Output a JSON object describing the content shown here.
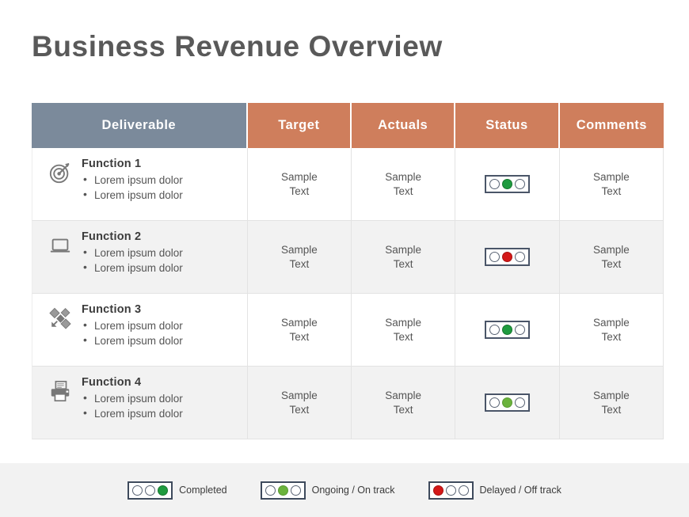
{
  "slide": {
    "title": "Business Revenue Overview",
    "background": "#ffffff",
    "title_color": "#595959"
  },
  "colors": {
    "header_deliverable": "#7b8a9b",
    "header_accent": "#cf7e5c",
    "row_shaded": "#f2f2f2",
    "footer_band": "#f2f2f2",
    "status_green": "#1f9b3f",
    "status_green_light": "#6bb33c",
    "status_red": "#d41818",
    "lamp_outline": "#4a5568"
  },
  "table": {
    "headers": [
      {
        "label": "Deliverable",
        "style": "slate"
      },
      {
        "label": "Target",
        "style": "accent"
      },
      {
        "label": "Actuals",
        "style": "accent"
      },
      {
        "label": "Status",
        "style": "accent"
      },
      {
        "label": "Comments",
        "style": "accent"
      }
    ],
    "rows": [
      {
        "icon": "target-bullseye-icon",
        "title": "Function  1",
        "bullets": [
          "Lorem ipsum dolor",
          "Lorem ipsum dolor"
        ],
        "target": "Sample\nText",
        "target_line1": "Sample",
        "target_line2": "Text",
        "actuals_line1": "Sample",
        "actuals_line2": "Text",
        "comments_line1": "Sample",
        "comments_line2": "Text",
        "status": "ongoing",
        "status_lamps": [
          "off",
          "green",
          "off"
        ],
        "shaded": false
      },
      {
        "icon": "laptop-icon",
        "title": "Function  2",
        "bullets": [
          "Lorem ipsum dolor",
          "Lorem ipsum dolor"
        ],
        "target_line1": "Sample",
        "target_line2": "Text",
        "actuals_line1": "Sample",
        "actuals_line2": "Text",
        "comments_line1": "Sample",
        "comments_line2": "Text",
        "status": "delayed",
        "status_lamps": [
          "off",
          "red",
          "off"
        ],
        "shaded": true
      },
      {
        "icon": "satellite-icon",
        "title": "Function  3",
        "bullets": [
          "Lorem ipsum dolor",
          "Lorem ipsum dolor"
        ],
        "target_line1": "Sample",
        "target_line2": "Text",
        "actuals_line1": "Sample",
        "actuals_line2": "Text",
        "comments_line1": "Sample",
        "comments_line2": "Text",
        "status": "ongoing",
        "status_lamps": [
          "off",
          "green",
          "off"
        ],
        "shaded": false
      },
      {
        "icon": "printer-icon",
        "title": "Function  4",
        "bullets": [
          "Lorem ipsum dolor",
          "Lorem ipsum dolor"
        ],
        "target_line1": "Sample",
        "target_line2": "Text",
        "actuals_line1": "Sample",
        "actuals_line2": "Text",
        "comments_line1": "Sample",
        "comments_line2": "Text",
        "status": "ongoing",
        "status_lamps": [
          "off",
          "green-light",
          "off"
        ],
        "shaded": true
      }
    ]
  },
  "legend": {
    "items": [
      {
        "label": "Completed",
        "lamps": [
          "off",
          "off",
          "green"
        ]
      },
      {
        "label": "Ongoing / On track",
        "lamps": [
          "off",
          "green-light",
          "off"
        ]
      },
      {
        "label": "Delayed / Off track",
        "lamps": [
          "red",
          "off",
          "off"
        ]
      }
    ]
  }
}
